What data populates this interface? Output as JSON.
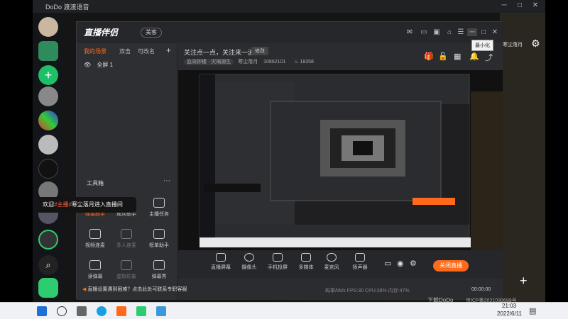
{
  "dodo": {
    "title": "DoDo 渡渡语音",
    "right_label": "寒尘落月"
  },
  "app": {
    "badge": "美客",
    "tooltip": "最小化",
    "scene_tabs": [
      "我的场景",
      "双击",
      "可改名"
    ],
    "scene_name": "全屏 1",
    "toolbox_title": "工具箱",
    "tools": [
      {
        "label": "弹幕助手"
      },
      {
        "label": "观众助手"
      },
      {
        "label": "主播任务"
      },
      {
        "label": "视频连麦"
      },
      {
        "label": "多人连麦"
      },
      {
        "label": "榜单助手"
      },
      {
        "label": "读弹幕"
      },
      {
        "label": "虚拟形象"
      },
      {
        "label": "弹幕秀"
      }
    ],
    "notice": "关注点一点，关注来一波",
    "modify": "修改",
    "category": "血染钟楼 · 灾祸源生",
    "username": "寒尘落月",
    "room_id": "10862101",
    "popularity": "18358",
    "bottom_buttons": [
      "直播屏幕",
      "摄像头",
      "手机投屏",
      "多媒体",
      "麦克风",
      "扬声器"
    ],
    "close_live": "关闭直播",
    "hint": "直播设置遇到困难？点击此处可联系专职客服",
    "stats": "码率/kb/s  FPS:30  CPU:38%  内存:47%",
    "stat_time": "00:00:00"
  },
  "welcome": {
    "prefix": "欢迎",
    "highlight": "#主播#",
    "suffix": "寒尘落月进入直播间"
  },
  "watermark": {
    "line1": "下载DoDo",
    "line2": "京ICP备2021030699号"
  },
  "taskbar": {
    "time": "21:03",
    "date": "2022/6/11"
  },
  "colors": {
    "accent": "#ff6a1a"
  }
}
